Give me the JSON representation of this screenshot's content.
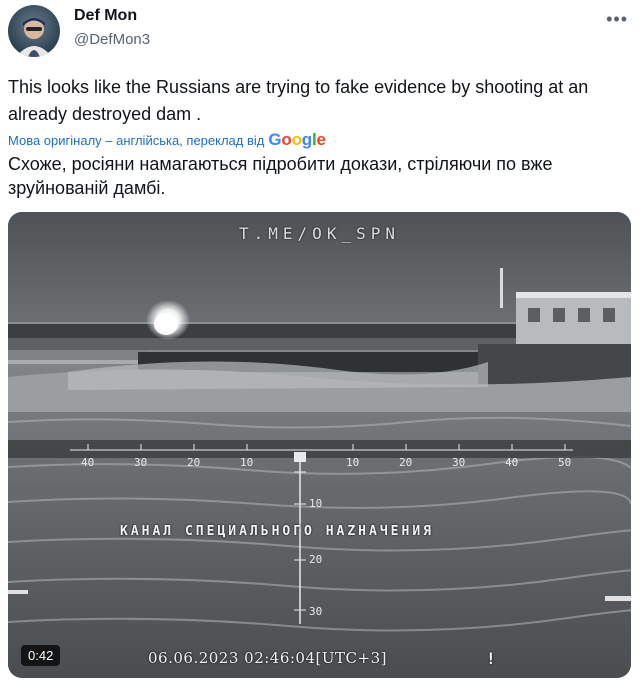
{
  "author": {
    "name": "Def Mon",
    "handle": "@DefMon3"
  },
  "tweet": {
    "text": "This looks like the Russians are trying to fake evidence by shooting at an already destroyed dam .",
    "translation_label": "Мова оригіналу – англійська, переклад від",
    "translation_provider": "Google",
    "translated_text": "Схоже, росіяни намагаються підробити докази, стріляючи по вже зруйнованій дамбі."
  },
  "video": {
    "watermark": "T.ME/OK_SPN",
    "channel_caption": "КАНАЛ СПЕЦИАЛЬНОГО НАZНАЧЕНИЯ",
    "timestamp": "06.06.2023  02:46:04[UTC+3]",
    "marker": "!",
    "duration": "0:42",
    "ruler_left": [
      "40",
      "30",
      "20",
      "10"
    ],
    "ruler_right": [
      "10",
      "20",
      "30",
      "40",
      "50"
    ],
    "ruler_vertical": [
      "10",
      "20",
      "30"
    ]
  },
  "icons": {
    "more": "more-horizontal-icon",
    "play": "video-player"
  }
}
